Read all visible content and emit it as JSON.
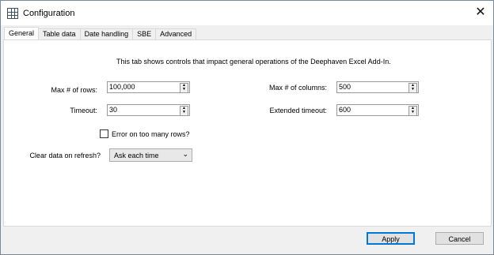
{
  "window": {
    "title": "Configuration",
    "close_glyph": "✕"
  },
  "tabs": [
    {
      "label": "General",
      "active": true
    },
    {
      "label": "Table data",
      "active": false
    },
    {
      "label": "Date handling",
      "active": false
    },
    {
      "label": "SBE",
      "active": false
    },
    {
      "label": "Advanced",
      "active": false
    }
  ],
  "general": {
    "description": "This tab shows controls that impact general operations of the Deephaven Excel Add-In.",
    "max_rows": {
      "label": "Max # of rows:",
      "value": "100,000"
    },
    "max_columns": {
      "label": "Max # of columns:",
      "value": "500"
    },
    "timeout": {
      "label": "Timeout:",
      "value": "30"
    },
    "extended_timeout": {
      "label": "Extended timeout:",
      "value": "600"
    },
    "error_checkbox": {
      "label": "Error on too many rows?",
      "checked": false
    },
    "clear_data": {
      "label": "Clear data on refresh?",
      "value": "Ask each time"
    }
  },
  "buttons": {
    "apply": "Apply",
    "cancel": "Cancel"
  },
  "icons": {
    "app": "grid-icon",
    "spin_up": "▲",
    "spin_down": "▼",
    "dropdown": "⌄"
  }
}
